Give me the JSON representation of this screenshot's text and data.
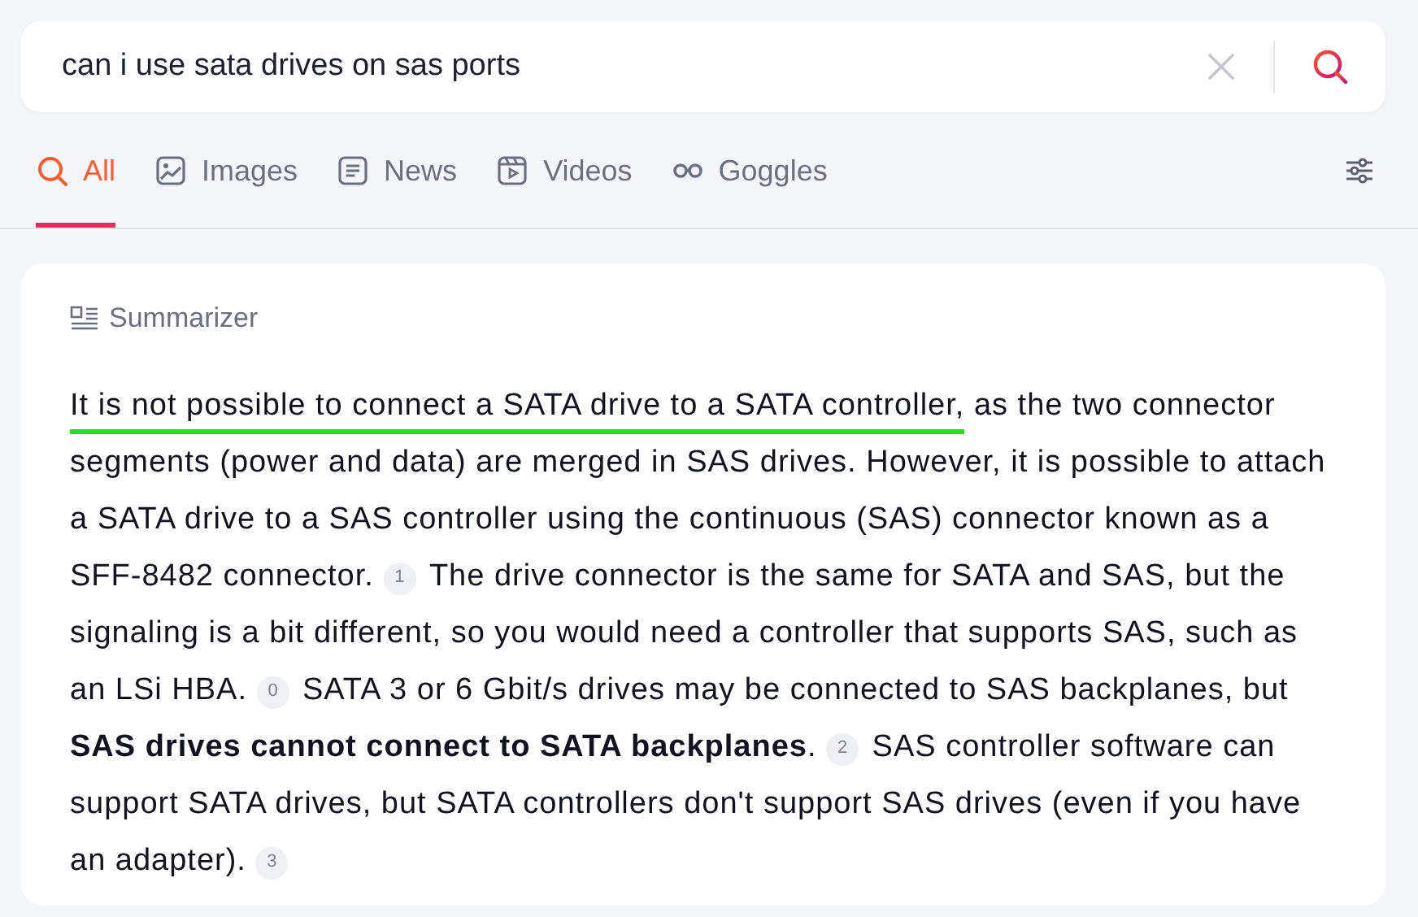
{
  "search": {
    "value": "can i use sata drives on sas ports"
  },
  "tabs": [
    {
      "label": "All",
      "selected": true
    },
    {
      "label": "Images",
      "selected": false
    },
    {
      "label": "News",
      "selected": false
    },
    {
      "label": "Videos",
      "selected": false
    },
    {
      "label": "Goggles",
      "selected": false
    }
  ],
  "summarizer": {
    "title": "Summarizer",
    "segments": [
      {
        "kind": "text",
        "text": "It is not possible to connect a SATA drive to a SATA controller,",
        "underlined": true
      },
      {
        "kind": "text",
        "text": " as the two connector segments (power and data) are merged in SAS drives. However, it is possible to attach a SATA drive to a SAS controller using the continuous (SAS) connector known as a SFF-8482 connector.",
        "underlined": false
      },
      {
        "kind": "citation",
        "label": "1"
      },
      {
        "kind": "text",
        "text": "The drive connector is the same for SATA and SAS, but the signaling is a bit different, so you would need a controller that supports SAS, such as an LSi HBA.",
        "underlined": false
      },
      {
        "kind": "citation",
        "label": "0"
      },
      {
        "kind": "text",
        "text": "SATA 3 or 6 Gbit/s drives may be connected to SAS backplanes, but **SAS drives cannot connect to SATA backplanes**.",
        "underlined": false
      },
      {
        "kind": "citation",
        "label": "2"
      },
      {
        "kind": "text",
        "text": "SAS controller software can support SATA drives, but SATA controllers don't support SAS drives (even if you have an adapter).",
        "underlined": false
      },
      {
        "kind": "citation",
        "label": "3"
      }
    ]
  }
}
